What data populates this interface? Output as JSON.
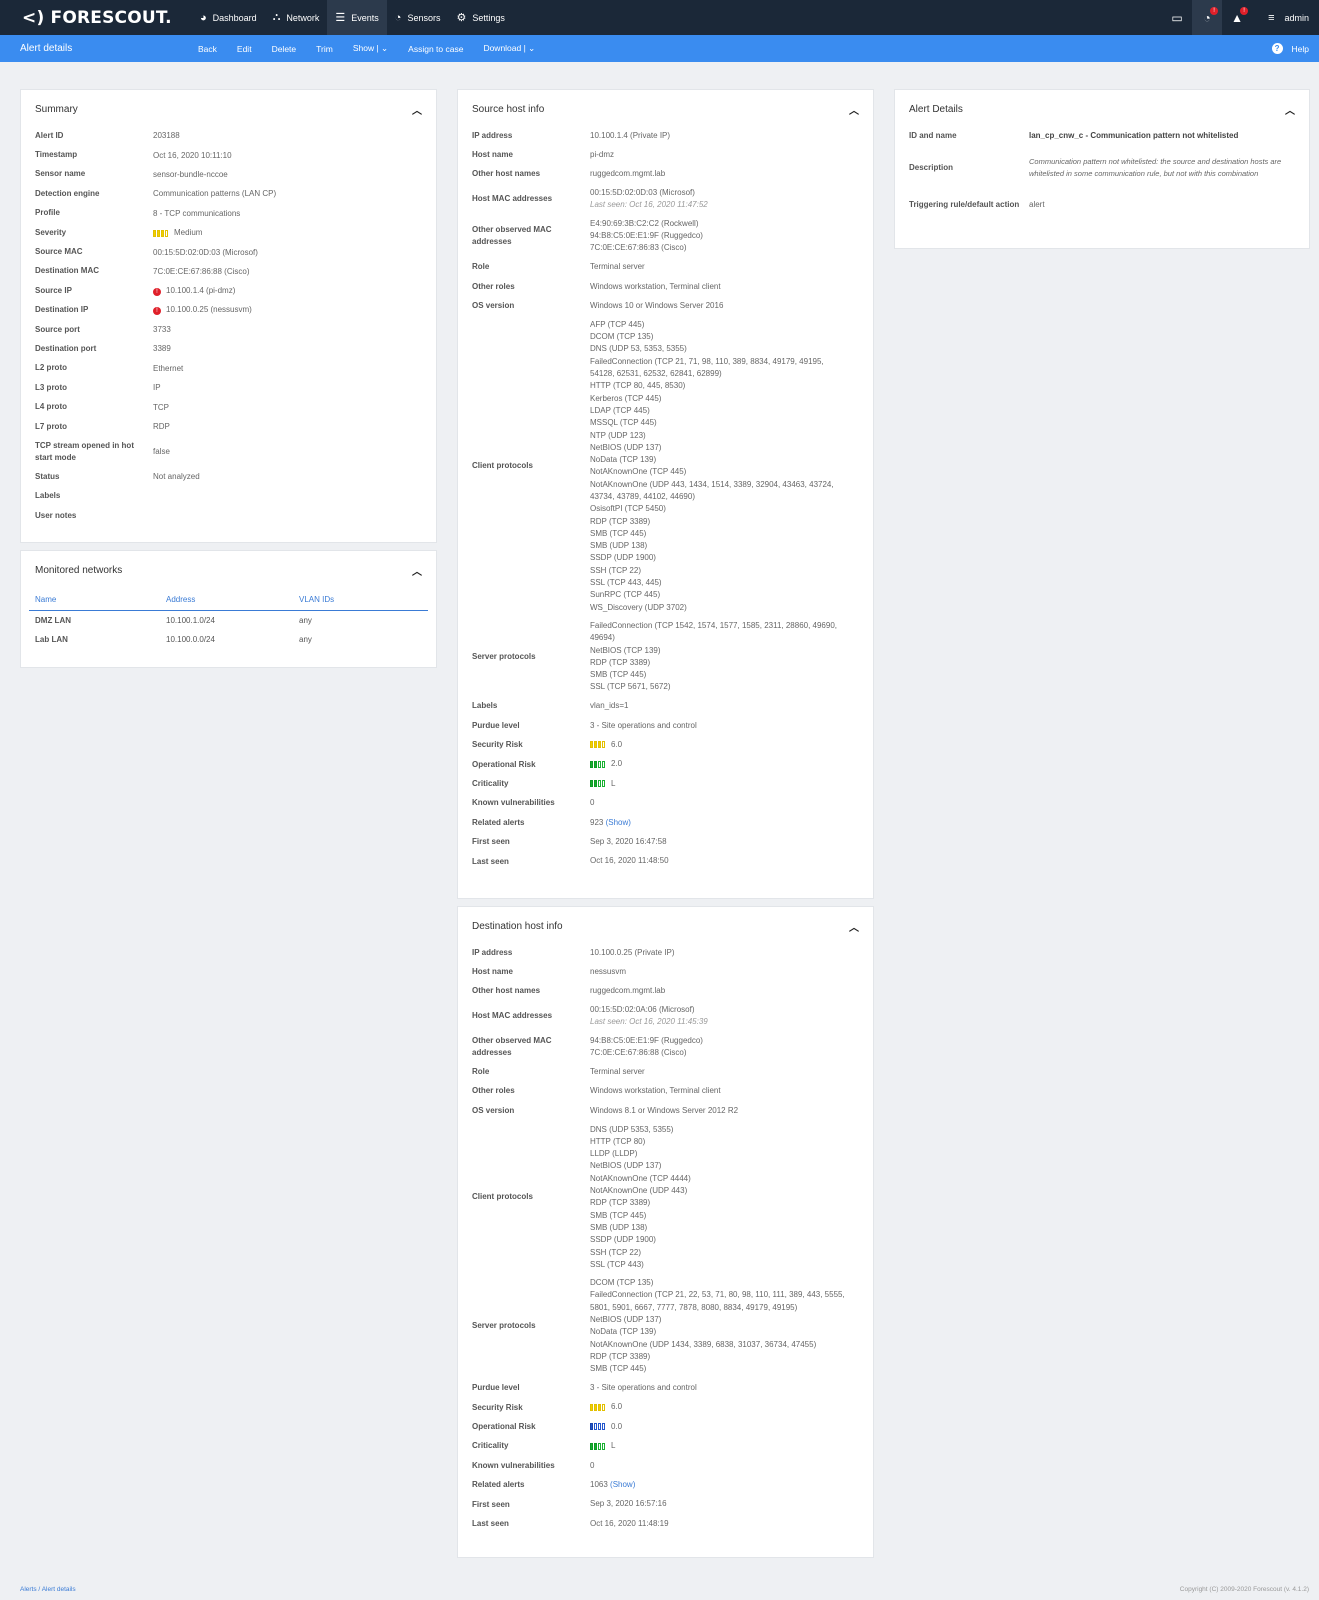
{
  "brand": "<) FORESCOUT.",
  "nav": [
    {
      "label": "Dashboard",
      "icon": "dashboard-icon",
      "glyph": "◕"
    },
    {
      "label": "Network",
      "icon": "network-icon",
      "glyph": "⛬"
    },
    {
      "label": "Events",
      "icon": "list-icon",
      "glyph": "☰"
    },
    {
      "label": "Sensors",
      "icon": "sensor-icon",
      "glyph": "◔"
    },
    {
      "label": "Settings",
      "icon": "settings-icon",
      "glyph": "⚙"
    }
  ],
  "topright": {
    "monitor_glyph": "▭",
    "feed_badge": "!",
    "bell_badge": "!",
    "menu_glyph": "≡",
    "user": "admin"
  },
  "actionbar": {
    "title": "Alert details",
    "buttons": [
      "Back",
      "Edit",
      "Delete",
      "Trim",
      "Show | ⌄",
      "Assign to case",
      "Download | ⌄"
    ],
    "help": "Help",
    "help_glyph": "?"
  },
  "summary": {
    "title": "Summary",
    "rows": [
      {
        "k": "Alert ID",
        "v": "203188"
      },
      {
        "k": "Timestamp",
        "v": "Oct 16, 2020 10:11:10"
      },
      {
        "k": "Sensor name",
        "v": "sensor-bundle-nccoe"
      },
      {
        "k": "Detection engine",
        "v": "Communication patterns (LAN CP)"
      },
      {
        "k": "Profile",
        "v": "8 - TCP communications"
      },
      {
        "k": "Severity",
        "v": "Medium"
      },
      {
        "k": "Source MAC",
        "v": "00:15:5D:02:0D:03 (Microsof)"
      },
      {
        "k": "Destination MAC",
        "v": "7C:0E:CE:67:86:88 (Cisco)"
      },
      {
        "k": "Source IP",
        "v": "10.100.1.4 (pi-dmz)"
      },
      {
        "k": "Destination IP",
        "v": "10.100.0.25 (nessusvm)"
      },
      {
        "k": "Source port",
        "v": "3733"
      },
      {
        "k": "Destination port",
        "v": "3389"
      },
      {
        "k": "L2 proto",
        "v": "Ethernet"
      },
      {
        "k": "L3 proto",
        "v": "IP"
      },
      {
        "k": "L4 proto",
        "v": "TCP"
      },
      {
        "k": "L7 proto",
        "v": "RDP"
      },
      {
        "k": "TCP stream opened in hot start mode",
        "v": "false"
      },
      {
        "k": "Status",
        "v": "Not analyzed"
      },
      {
        "k": "Labels",
        "v": ""
      },
      {
        "k": "User notes",
        "v": ""
      }
    ],
    "severity_level": 3,
    "severity_max": 4,
    "alert_glyph": "!"
  },
  "monitored": {
    "title": "Monitored networks",
    "headers": [
      "Name",
      "Address",
      "VLAN IDs"
    ],
    "rows": [
      [
        "DMZ LAN",
        "10.100.1.0/24",
        "any"
      ],
      [
        "Lab LAN",
        "10.100.0.0/24",
        "any"
      ]
    ]
  },
  "source": {
    "title": "Source host info",
    "rows": [
      {
        "k": "IP address",
        "v": "10.100.1.4 (Private IP)"
      },
      {
        "k": "Host name",
        "v": "pi-dmz"
      },
      {
        "k": "Other host names",
        "v": "ruggedcom.mgmt.lab"
      },
      {
        "k": "Host MAC addresses",
        "v": "00:15:5D:02:0D:03 (Microsof)",
        "sub": "Last seen: Oct 16, 2020 11:47:52"
      },
      {
        "k": "Other observed MAC addresses",
        "v": "E4:90:69:3B:C2:C2 (Rockwell)\n94:B8:C5:0E:E1:9F (Ruggedco)\n7C:0E:CE:67:86:83 (Cisco)"
      },
      {
        "k": "Role",
        "v": "Terminal server"
      },
      {
        "k": "Other roles",
        "v": "Windows workstation, Terminal client"
      },
      {
        "k": "OS version",
        "v": "Windows 10 or Windows Server 2016"
      },
      {
        "k": "Client protocols",
        "v": "AFP (TCP 445)\nDCOM (TCP 135)\nDNS (UDP 53, 5353, 5355)\nFailedConnection (TCP 21, 71, 98, 110, 389, 8834, 49179, 49195,\n54128, 62531, 62532, 62841, 62899)\nHTTP (TCP 80, 445, 8530)\nKerberos (TCP 445)\nLDAP (TCP 445)\nMSSQL (TCP 445)\nNTP (UDP 123)\nNetBIOS (UDP 137)\nNoData (TCP 139)\nNotAKnownOne (TCP 445)\nNotAKnownOne (UDP 443, 1434, 1514, 3389, 32904, 43463, 43724,\n43734, 43789, 44102, 44690)\nOsisoftPI (TCP 5450)\nRDP (TCP 3389)\nSMB (TCP 445)\nSMB (UDP 138)\nSSDP (UDP 1900)\nSSH (TCP 22)\nSSL (TCP 443, 445)\nSunRPC (TCP 445)\nWS_Discovery (UDP 3702)"
      },
      {
        "k": "Server protocols",
        "v": "FailedConnection (TCP 1542, 1574, 1577, 1585, 2311, 28860, 49690,\n49694)\nNetBIOS (TCP 139)\nRDP (TCP 3389)\nSMB (TCP 445)\nSSL (TCP 5671, 5672)"
      },
      {
        "k": "Labels",
        "v": "vlan_ids=1"
      },
      {
        "k": "Purdue level",
        "v": "3 - Site operations and control"
      },
      {
        "k": "Security Risk",
        "v": "6.0",
        "bars": "y",
        "level": 3
      },
      {
        "k": "Operational Risk",
        "v": "2.0",
        "bars": "g",
        "level": 2
      },
      {
        "k": "Criticality",
        "v": "L",
        "bars": "g",
        "level": 2
      },
      {
        "k": "Known vulnerabilities",
        "v": "0"
      },
      {
        "k": "Related alerts",
        "v": "923",
        "link": "(Show)"
      },
      {
        "k": "First seen",
        "v": "Sep 3, 2020 16:47:58"
      },
      {
        "k": "Last seen",
        "v": "Oct 16, 2020 11:48:50"
      }
    ]
  },
  "destination": {
    "title": "Destination host info",
    "rows": [
      {
        "k": "IP address",
        "v": "10.100.0.25 (Private IP)"
      },
      {
        "k": "Host name",
        "v": "nessusvm"
      },
      {
        "k": "Other host names",
        "v": "ruggedcom.mgmt.lab"
      },
      {
        "k": "Host MAC addresses",
        "v": "00:15:5D:02:0A:06 (Microsof)",
        "sub": "Last seen: Oct 16, 2020 11:45:39"
      },
      {
        "k": "Other observed MAC addresses",
        "v": "94:B8:C5:0E:E1:9F (Ruggedco)\n7C:0E:CE:67:86:88 (Cisco)"
      },
      {
        "k": "Role",
        "v": "Terminal server"
      },
      {
        "k": "Other roles",
        "v": "Windows workstation, Terminal client"
      },
      {
        "k": "OS version",
        "v": "Windows 8.1 or Windows Server 2012 R2"
      },
      {
        "k": "Client protocols",
        "v": "DNS (UDP 5353, 5355)\nHTTP (TCP 80)\nLLDP (LLDP)\nNetBIOS (UDP 137)\nNotAKnownOne (TCP 4444)\nNotAKnownOne (UDP 443)\nRDP (TCP 3389)\nSMB (TCP 445)\nSMB (UDP 138)\nSSDP (UDP 1900)\nSSH (TCP 22)\nSSL (TCP 443)"
      },
      {
        "k": "Server protocols",
        "v": "DCOM (TCP 135)\nFailedConnection (TCP 21, 22, 53, 71, 80, 98, 110, 111, 389, 443, 5555,\n5801, 5901, 6667, 7777, 7878, 8080, 8834, 49179, 49195)\nNetBIOS (UDP 137)\nNoData (TCP 139)\nNotAKnownOne (UDP 1434, 3389, 6838, 31037, 36734, 47455)\nRDP (TCP 3389)\nSMB (TCP 445)"
      },
      {
        "k": "Purdue level",
        "v": "3 - Site operations and control"
      },
      {
        "k": "Security Risk",
        "v": "6.0",
        "bars": "y",
        "level": 3
      },
      {
        "k": "Operational Risk",
        "v": "0.0",
        "bars": "b",
        "level": 1
      },
      {
        "k": "Criticality",
        "v": "L",
        "bars": "g",
        "level": 2
      },
      {
        "k": "Known vulnerabilities",
        "v": "0"
      },
      {
        "k": "Related alerts",
        "v": "1063",
        "link": "(Show)"
      },
      {
        "k": "First seen",
        "v": "Sep 3, 2020 16:57:16"
      },
      {
        "k": "Last seen",
        "v": "Oct 16, 2020 11:48:19"
      }
    ]
  },
  "alert_details": {
    "title": "Alert Details",
    "id_label": "ID and name",
    "id_value": "lan_cp_cnw_c - Communication pattern not whitelisted",
    "desc_label": "Description",
    "desc_value": "Communication pattern not whitelisted: the source and destination hosts are whitelisted in some communication rule, but not with this combination",
    "rule_label": "Triggering rule/default action",
    "rule_value": "alert"
  },
  "footer": {
    "crumb1": "Alerts /",
    "crumb2": "Alert details",
    "copyright": "Copyright (C) 2009-2020 Forescout (v. 4.1.2)"
  },
  "colors": {
    "topbar": "#1b2838",
    "actionbar": "#3a8cf0",
    "link": "#3a7bd5",
    "alert": "#e0202a"
  }
}
